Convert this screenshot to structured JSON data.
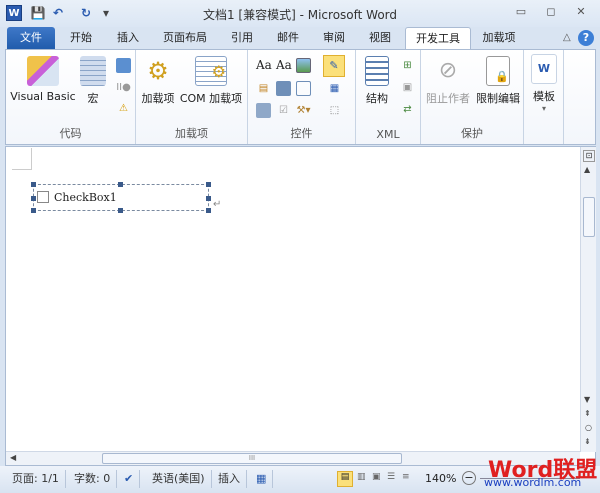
{
  "window": {
    "title": "文档1 [兼容模式] - Microsoft Word"
  },
  "qat": {
    "word": "W",
    "save": "💾",
    "undo": "↶",
    "redo": "↻",
    "customize": "▾"
  },
  "tabs": [
    "文件",
    "开始",
    "插入",
    "页面布局",
    "引用",
    "邮件",
    "审阅",
    "视图",
    "开发工具",
    "加载项"
  ],
  "ribbon": {
    "code": {
      "label": "代码",
      "visual_basic": "Visual Basic",
      "macro": "宏"
    },
    "addins": {
      "label": "加载项",
      "addins": "加载项",
      "com_addins": "COM 加载项"
    },
    "controls": {
      "label": "控件",
      "aa1": "Aa",
      "aa2": "Aa"
    },
    "xml": {
      "label": "XML",
      "structure": "结构"
    },
    "protect": {
      "label": "保护",
      "block_authors": "阻止作者",
      "restrict_editing": "限制编辑"
    },
    "templates": {
      "label": "",
      "template": "模板"
    }
  },
  "document": {
    "checkbox_label": "CheckBox1"
  },
  "status": {
    "page": "页面: 1/1",
    "words": "字数: 0",
    "language": "英语(美国)",
    "mode": "插入",
    "zoom": "140%"
  },
  "watermark": {
    "brand": "Word联盟",
    "url": "www.wordlm.com"
  }
}
